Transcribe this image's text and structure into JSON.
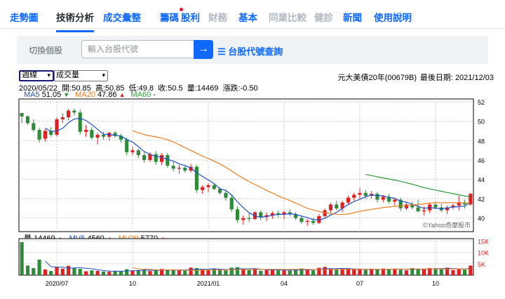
{
  "tabs": [
    {
      "label": "走勢圖",
      "state": "normal"
    },
    {
      "label": "技術分析",
      "state": "active"
    },
    {
      "label": "成交彙整",
      "state": "normal"
    },
    {
      "label": "籌碼",
      "state": "normal",
      "dot": true
    },
    {
      "label": "股利",
      "state": "normal"
    },
    {
      "label": "財務",
      "state": "disabled"
    },
    {
      "label": "基本",
      "state": "normal"
    },
    {
      "label": "同業比較",
      "state": "disabled"
    },
    {
      "label": "健診",
      "state": "disabled"
    },
    {
      "label": "新聞",
      "state": "normal"
    },
    {
      "label": "使用說明",
      "state": "normal"
    }
  ],
  "search": {
    "label": "切換個股",
    "placeholder": "輸入台股代號",
    "go_icon": "arrow-right-icon",
    "query_link": "台股代號查詢",
    "query_icon": "list-icon"
  },
  "controls": {
    "period_select": "週線",
    "indicator_select": "成交量",
    "stock_name": "元大美債20年(00679B)",
    "last_date": "最後日期: 2021/12/03"
  },
  "ohlc": "2020/05/22  開:50.85  高:50.85  低:49.8  收:50.5  量:14469  漲跌:-0.50",
  "ma_legend": [
    {
      "label": "MA5",
      "value": "51.05",
      "arrow": "▼",
      "color": "#1f4fc8"
    },
    {
      "label": "MA20",
      "value": "47.86",
      "arrow": "▲",
      "color": "#f07a1e"
    },
    {
      "label": "MA60",
      "value": "-",
      "arrow": "",
      "color": "#2e9a3a"
    }
  ],
  "vol_legend": [
    {
      "label": "量",
      "value": "14469",
      "arrow": "▲",
      "color": "#000000"
    },
    {
      "label": "MV5",
      "value": "4560",
      "arrow": "▲",
      "color": "#1f4fc8"
    },
    {
      "label": "MV20",
      "value": "5770",
      "arrow": "▲",
      "color": "#f07a1e"
    }
  ],
  "watermark": "©Yahoo奇摩股市",
  "colors": {
    "up": "#e02020",
    "down": "#2e8b3a",
    "ma5": "#1f4fc8",
    "ma20": "#f07a1e",
    "ma60": "#2e9a3a",
    "accent": "#0f69ff"
  },
  "chart_data": {
    "type": "candlestick",
    "y_ticks": [
      40,
      42,
      44,
      46,
      48,
      50,
      52
    ],
    "y_range": [
      38.6,
      52.3
    ],
    "vol_ticks": [
      "5K",
      "10K",
      "15K"
    ],
    "vol_range": [
      0,
      16000
    ],
    "x_tick_labels": [
      {
        "label": "2020/07",
        "index": 6
      },
      {
        "label": "10",
        "index": 19
      },
      {
        "label": "2021/01",
        "index": 32
      },
      {
        "label": "04",
        "index": 45
      },
      {
        "label": "07",
        "index": 58
      },
      {
        "label": "10",
        "index": 71
      }
    ],
    "candles": [
      [
        50.85,
        50.85,
        49.8,
        50.5
      ],
      [
        50.5,
        50.6,
        49.6,
        49.8
      ],
      [
        49.8,
        50.2,
        48.9,
        49.1
      ],
      [
        49.1,
        49.3,
        47.8,
        48.1
      ],
      [
        48.2,
        49.2,
        47.9,
        49.0
      ],
      [
        49.0,
        49.4,
        48.4,
        48.6
      ],
      [
        48.6,
        50.4,
        48.4,
        50.2
      ],
      [
        50.2,
        50.8,
        49.8,
        50.4
      ],
      [
        50.4,
        51.3,
        50.1,
        51.1
      ],
      [
        51.1,
        51.3,
        50.6,
        50.9
      ],
      [
        50.9,
        51.2,
        48.6,
        48.9
      ],
      [
        48.9,
        49.6,
        48.4,
        49.1
      ],
      [
        49.1,
        49.4,
        48.1,
        48.3
      ],
      [
        48.3,
        48.8,
        47.6,
        48.6
      ],
      [
        48.6,
        48.9,
        48.1,
        48.4
      ],
      [
        48.4,
        48.9,
        48.0,
        48.8
      ],
      [
        48.8,
        49.0,
        48.3,
        48.5
      ],
      [
        48.5,
        48.7,
        47.8,
        48.1
      ],
      [
        48.1,
        48.3,
        46.5,
        46.8
      ],
      [
        46.8,
        47.4,
        46.5,
        47.0
      ],
      [
        47.0,
        47.2,
        46.2,
        46.5
      ],
      [
        46.5,
        46.8,
        45.7,
        46.0
      ],
      [
        46.0,
        46.8,
        45.8,
        46.6
      ],
      [
        46.6,
        46.9,
        45.5,
        45.8
      ],
      [
        45.8,
        46.7,
        45.5,
        46.5
      ],
      [
        46.5,
        46.7,
        45.2,
        45.4
      ],
      [
        45.4,
        45.8,
        44.8,
        45.1
      ],
      [
        45.1,
        45.5,
        44.6,
        45.2
      ],
      [
        45.2,
        45.4,
        44.7,
        44.9
      ],
      [
        44.9,
        45.6,
        44.7,
        45.3
      ],
      [
        45.3,
        45.5,
        42.6,
        42.9
      ],
      [
        42.9,
        43.4,
        42.5,
        43.2
      ],
      [
        43.2,
        43.6,
        42.7,
        43.4
      ],
      [
        43.4,
        43.6,
        42.9,
        43.0
      ],
      [
        43.0,
        43.2,
        42.4,
        42.6
      ],
      [
        42.6,
        42.9,
        41.8,
        42.1
      ],
      [
        42.1,
        42.4,
        40.6,
        40.9
      ],
      [
        40.9,
        41.2,
        39.5,
        39.8
      ],
      [
        39.8,
        40.3,
        39.3,
        40.0
      ],
      [
        40.0,
        40.5,
        39.6,
        39.9
      ],
      [
        39.9,
        40.7,
        39.8,
        40.6
      ],
      [
        40.6,
        40.8,
        39.8,
        40.1
      ],
      [
        40.1,
        40.6,
        39.7,
        40.3
      ],
      [
        40.3,
        40.7,
        39.9,
        40.5
      ],
      [
        40.5,
        40.8,
        40.1,
        40.4
      ],
      [
        40.4,
        40.8,
        39.9,
        40.6
      ],
      [
        40.6,
        40.9,
        40.2,
        40.4
      ],
      [
        40.4,
        40.6,
        39.8,
        40.0
      ],
      [
        40.0,
        40.3,
        39.4,
        39.6
      ],
      [
        39.6,
        39.9,
        39.2,
        39.7
      ],
      [
        39.7,
        40.0,
        39.3,
        39.5
      ],
      [
        39.5,
        40.4,
        39.4,
        40.2
      ],
      [
        40.2,
        41.0,
        40.0,
        40.8
      ],
      [
        40.8,
        41.6,
        40.5,
        41.4
      ],
      [
        41.4,
        41.8,
        40.8,
        41.0
      ],
      [
        41.0,
        41.8,
        40.6,
        41.6
      ],
      [
        41.6,
        42.3,
        41.4,
        42.1
      ],
      [
        42.1,
        42.6,
        41.8,
        42.4
      ],
      [
        42.4,
        43.1,
        42.0,
        42.6
      ],
      [
        42.6,
        42.9,
        42.0,
        42.3
      ],
      [
        42.3,
        42.8,
        42.0,
        42.5
      ],
      [
        42.5,
        42.7,
        41.6,
        41.9
      ],
      [
        41.9,
        42.4,
        41.6,
        42.2
      ],
      [
        42.2,
        42.5,
        41.5,
        41.7
      ],
      [
        41.7,
        42.1,
        41.3,
        41.9
      ],
      [
        41.9,
        42.1,
        40.7,
        41.0
      ],
      [
        41.0,
        41.6,
        40.8,
        41.4
      ],
      [
        41.4,
        41.7,
        40.9,
        41.1
      ],
      [
        41.1,
        41.9,
        40.6,
        40.7
      ],
      [
        40.7,
        41.2,
        40.3,
        40.8
      ],
      [
        40.8,
        41.6,
        40.5,
        41.4
      ],
      [
        41.4,
        41.7,
        40.9,
        41.1
      ],
      [
        41.1,
        41.5,
        40.6,
        40.8
      ],
      [
        40.8,
        41.3,
        40.4,
        41.1
      ],
      [
        41.1,
        41.5,
        40.9,
        41.3
      ],
      [
        41.3,
        42.3,
        40.8,
        41.6
      ],
      [
        41.6,
        41.9,
        41.0,
        41.4
      ],
      [
        41.4,
        42.6,
        41.3,
        42.5
      ]
    ],
    "volumes": [
      14469,
      4200,
      3100,
      6800,
      2500,
      1800,
      3600,
      2900,
      4100,
      3300,
      2800,
      1700,
      2100,
      1900,
      1600,
      1500,
      1800,
      1700,
      2600,
      1900,
      2200,
      2400,
      1800,
      2000,
      2700,
      2300,
      2500,
      2100,
      1900,
      3300,
      3100,
      2600,
      2200,
      2800,
      2400,
      2100,
      3300,
      3500,
      2600,
      2200,
      2800,
      1900,
      2200,
      2500,
      2100,
      2300,
      2000,
      2400,
      2900,
      2300,
      2100,
      3200,
      3600,
      2900,
      2400,
      2600,
      3000,
      2700,
      2500,
      2300,
      2700,
      2600,
      2900,
      2500,
      2800,
      2400,
      2100,
      3100,
      2600,
      2700,
      3100,
      2800,
      2900,
      3300,
      2200,
      2600,
      2400,
      4200
    ]
  }
}
